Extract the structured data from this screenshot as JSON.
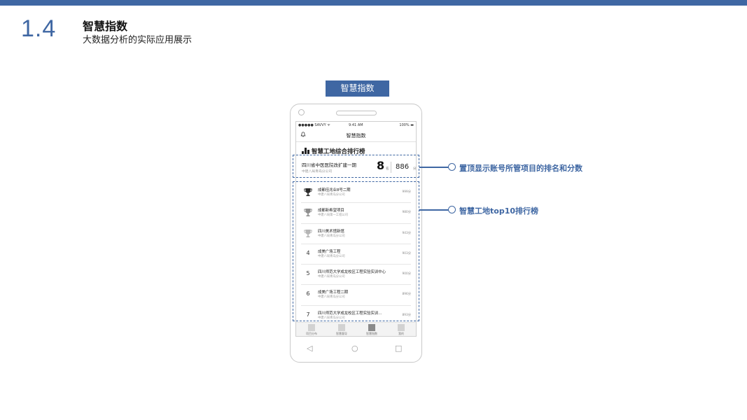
{
  "slide": {
    "section_number": "1.4",
    "title": "智慧指数",
    "subtitle": "大数据分析的实际应用展示",
    "tag_label": "智慧指数",
    "accent_color": "#3f67a3"
  },
  "phone": {
    "status": {
      "carrier": "●●●●● SAVVY ᯤ",
      "time": "9:41 AM",
      "battery": "100% ▬"
    },
    "nav": {
      "title": "智慧指数",
      "left_icon": "bell-icon"
    },
    "section_heading": "智慧工地综合排行榜",
    "my_project": {
      "name": "四川省中医医院改扩建一期",
      "org": "中建八局青岛分公司",
      "rank": "8",
      "rank_unit": "名",
      "score": "886",
      "score_unit": "分"
    },
    "ranking": [
      {
        "rank": "1",
        "name": "成都佳兆业8号二期",
        "org": "中建八局青岛分公司",
        "score": "999分",
        "trophy": "gold"
      },
      {
        "rank": "2",
        "name": "成都新希望项目",
        "org": "中建八局第一工程公司",
        "score": "980分",
        "trophy": "silver"
      },
      {
        "rank": "3",
        "name": "四川美术馆新馆",
        "org": "中建八局青岛分公司",
        "score": "943分",
        "trophy": "bronze"
      },
      {
        "rank": "4",
        "name": "成美广场工程",
        "org": "中建八局青岛分公司",
        "score": "903分"
      },
      {
        "rank": "5",
        "name": "四川师范大学成龙校区工程实验实训中心",
        "org": "中建八局青岛分公司",
        "score": "900分"
      },
      {
        "rank": "6",
        "name": "成美广场工程二期",
        "org": "中建八局青岛分公司",
        "score": "896分"
      },
      {
        "rank": "7",
        "name": "四川师范大学成龙校区工程实验实训…",
        "org": "中建八局青岛分公司",
        "score": "893分"
      }
    ],
    "tabs": [
      {
        "label": "项目分布"
      },
      {
        "label": "智慧督导"
      },
      {
        "label": "智慧指数"
      },
      {
        "label": "我的"
      }
    ],
    "softkeys": {
      "back": "◁",
      "home": "○",
      "recent": "□"
    }
  },
  "callouts": {
    "top": "置顶显示账号所管项目的排名和分数",
    "list": "智慧工地top10排行榜"
  }
}
